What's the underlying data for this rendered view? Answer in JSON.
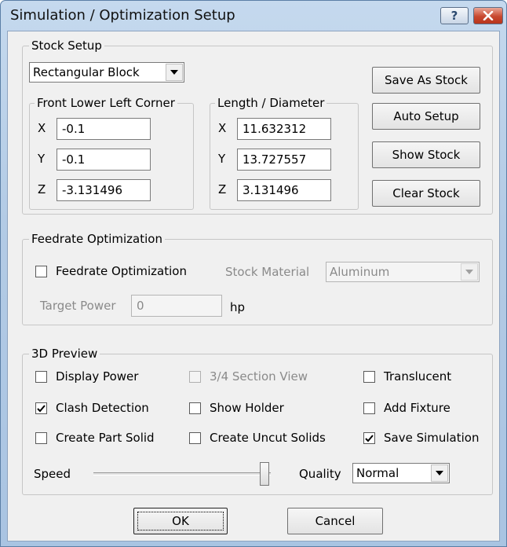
{
  "window": {
    "title": "Simulation / Optimization Setup",
    "help_glyph": "?"
  },
  "stock_setup": {
    "label": "Stock Setup",
    "shape": "Rectangular Block",
    "front_lower_left": {
      "label": "Front Lower Left Corner",
      "x_label": "X",
      "x": "-0.1",
      "y_label": "Y",
      "y": "-0.1",
      "z_label": "Z",
      "z": "-3.131496"
    },
    "length_diameter": {
      "label": "Length / Diameter",
      "x_label": "X",
      "x": "11.632312",
      "y_label": "Y",
      "y": "13.727557",
      "z_label": "Z",
      "z": "3.131496"
    },
    "buttons": {
      "save_as_stock": "Save As Stock",
      "auto_setup": "Auto Setup",
      "show_stock": "Show Stock",
      "clear_stock": "Clear Stock"
    }
  },
  "feedrate": {
    "label": "Feedrate Optimization",
    "checkbox_label": "Feedrate Optimization",
    "checked": false,
    "stock_material_label": "Stock Material",
    "stock_material": "Aluminum",
    "target_power_label": "Target Power",
    "target_power": "0",
    "target_power_unit": "hp"
  },
  "preview": {
    "label": "3D Preview",
    "display_power": {
      "label": "Display Power",
      "checked": false
    },
    "section_view": {
      "label": "3/4 Section View",
      "checked": false
    },
    "translucent": {
      "label": "Translucent",
      "checked": false
    },
    "clash_detection": {
      "label": "Clash Detection",
      "checked": true
    },
    "show_holder": {
      "label": "Show Holder",
      "checked": false
    },
    "add_fixture": {
      "label": "Add Fixture",
      "checked": false
    },
    "create_part_solid": {
      "label": "Create Part Solid",
      "checked": false
    },
    "create_uncut_solids": {
      "label": "Create Uncut Solids",
      "checked": false
    },
    "save_simulation": {
      "label": "Save Simulation",
      "checked": true
    },
    "speed_label": "Speed",
    "speed_level": 1.0,
    "quality_label": "Quality",
    "quality": "Normal"
  },
  "footer": {
    "ok": "OK",
    "cancel": "Cancel"
  },
  "icons": {
    "help": "help-icon",
    "close": "close-icon",
    "dropdown": "chevron-down-icon",
    "check": "check-icon"
  }
}
